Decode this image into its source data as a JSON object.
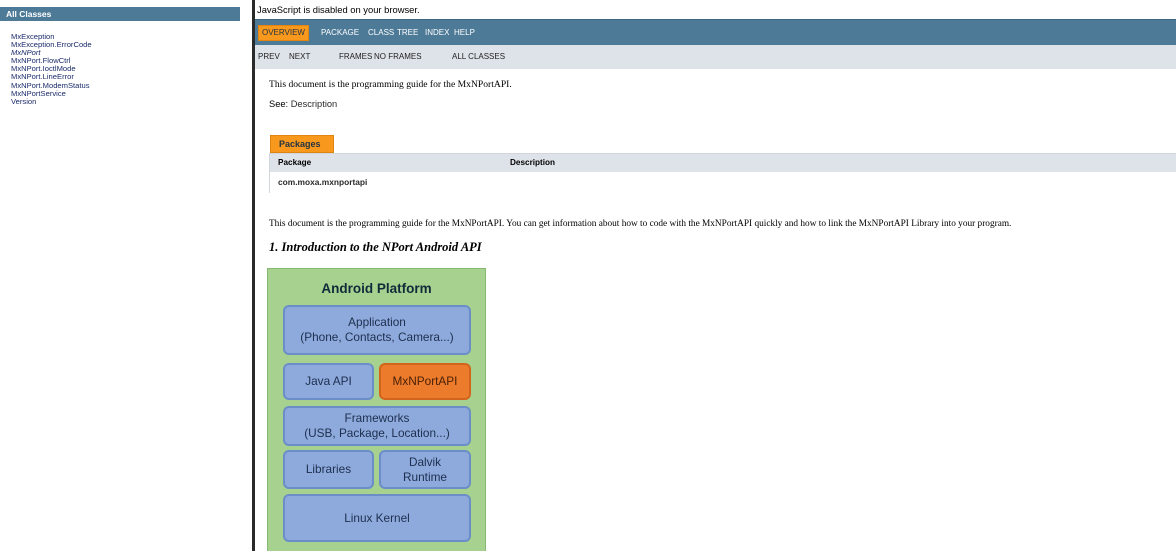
{
  "left_frame": {
    "header": "All Classes",
    "classes": [
      {
        "label": "MxException",
        "italic": false
      },
      {
        "label": "MxException.ErrorCode",
        "italic": false
      },
      {
        "label": "MxNPort",
        "italic": true
      },
      {
        "label": "MxNPort.FlowCtrl",
        "italic": false
      },
      {
        "label": "MxNPort.IoctlMode",
        "italic": false
      },
      {
        "label": "MxNPort.LineError",
        "italic": false
      },
      {
        "label": "MxNPort.ModemStatus",
        "italic": false
      },
      {
        "label": "MxNPortService",
        "italic": false
      },
      {
        "label": "Version",
        "italic": false
      }
    ]
  },
  "right_frame": {
    "js_warning": "JavaScript is disabled on your browser.",
    "top_nav": {
      "overview": "OVERVIEW",
      "package": "PACKAGE",
      "class": "CLASS",
      "tree": "TREE",
      "index": "INDEX",
      "help": "HELP"
    },
    "sub_nav": {
      "prev": "PREV",
      "next": "NEXT",
      "frames": "FRAMES",
      "no_frames": "NO FRAMES",
      "all_classes": "ALL CLASSES"
    },
    "description_line": "This document is the programming guide for the MxNPortAPI.",
    "see_label": "See:",
    "see_link": "Description",
    "packages": {
      "tab_label": "Packages",
      "columns": [
        "Package",
        "Description"
      ],
      "rows": [
        {
          "package": "com.moxa.mxnportapi",
          "description": ""
        }
      ]
    },
    "long_description": "This document is the programming guide for the MxNPortAPI. You can get information about how to code with the MxNPortAPI quickly and how to link the MxNPortAPI Library into your program.",
    "section_heading": "1. Introduction to the NPort Android API"
  },
  "diagram": {
    "title": "Android Platform",
    "application_line1": "Application",
    "application_line2": "(Phone, Contacts, Camera...)",
    "java_api": "Java API",
    "mxnportapi": "MxNPortAPI",
    "frameworks_line1": "Frameworks",
    "frameworks_line2": "(USB, Package, Location...)",
    "libraries": "Libraries",
    "dalvik_line1": "Dalvik",
    "dalvik_line2": "Runtime",
    "linux_kernel": "Linux Kernel",
    "colors": {
      "background": "#a7d18f",
      "box": "#8eaadc",
      "highlight": "#ec7b2b"
    }
  },
  "colors": {
    "nav_bar": "#4d7a97",
    "active_tab": "#f8981d",
    "sub_nav": "#dee3e9"
  }
}
